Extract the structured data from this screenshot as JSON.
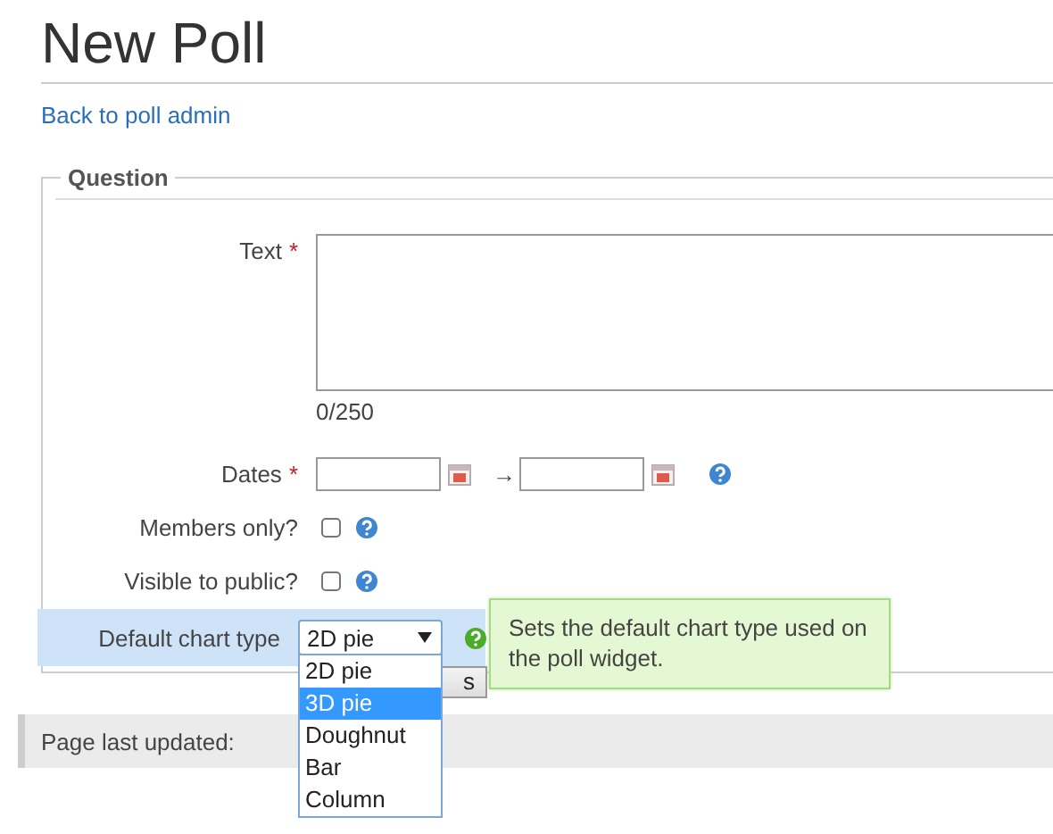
{
  "page": {
    "title": "New Poll",
    "back_link": "Back to poll admin"
  },
  "fieldset": {
    "legend": "Question",
    "fields": [
      {
        "kind": "textarea",
        "label": "Text",
        "required_mark": "*",
        "counter": "0/250"
      },
      {
        "kind": "daterange",
        "label": "Dates",
        "required_mark": "*",
        "arrow": "→"
      },
      {
        "kind": "checkbox",
        "label": "Members only?",
        "checked": false
      },
      {
        "kind": "checkbox",
        "label": "Visible to public?",
        "checked": false
      },
      {
        "kind": "select",
        "label": "Default chart type",
        "highlighted": true,
        "value": "2D pie",
        "expanded": true,
        "options": [
          {
            "label": "2D pie",
            "highlighted": false
          },
          {
            "label": "3D pie",
            "highlighted": true
          },
          {
            "label": "Doughnut",
            "highlighted": false
          },
          {
            "label": "Bar",
            "highlighted": false
          },
          {
            "label": "Column",
            "highlighted": false
          }
        ],
        "tooltip": "Sets the default chart type used on the poll widget."
      }
    ],
    "button": {
      "label": "s"
    }
  },
  "footer": {
    "text": "Page last updated:"
  }
}
